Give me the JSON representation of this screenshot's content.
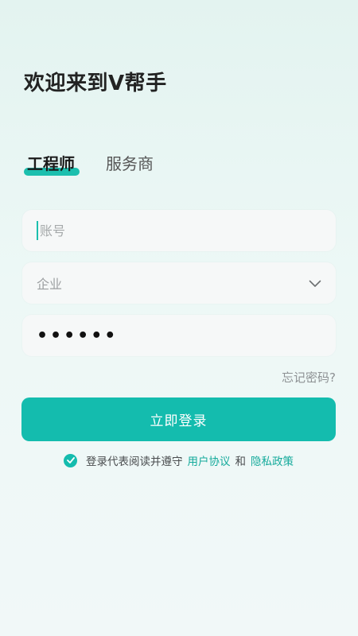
{
  "header": {
    "welcome": "欢迎来到V帮手"
  },
  "tabs": [
    {
      "label": "工程师",
      "active": true
    },
    {
      "label": "服务商",
      "active": false
    }
  ],
  "form": {
    "account": {
      "placeholder": "账号",
      "value": ""
    },
    "company": {
      "value": "企业"
    },
    "password": {
      "masked": "••••••"
    },
    "forgot_label": "忘记密码?",
    "login_label": "立即登录"
  },
  "agreement": {
    "checked": true,
    "prefix": "登录代表阅读并遵守",
    "user_agreement": "用户协议",
    "and": "和",
    "privacy_policy": "隐私政策"
  },
  "colors": {
    "accent": "#14bcae",
    "link": "#14aa9b"
  }
}
